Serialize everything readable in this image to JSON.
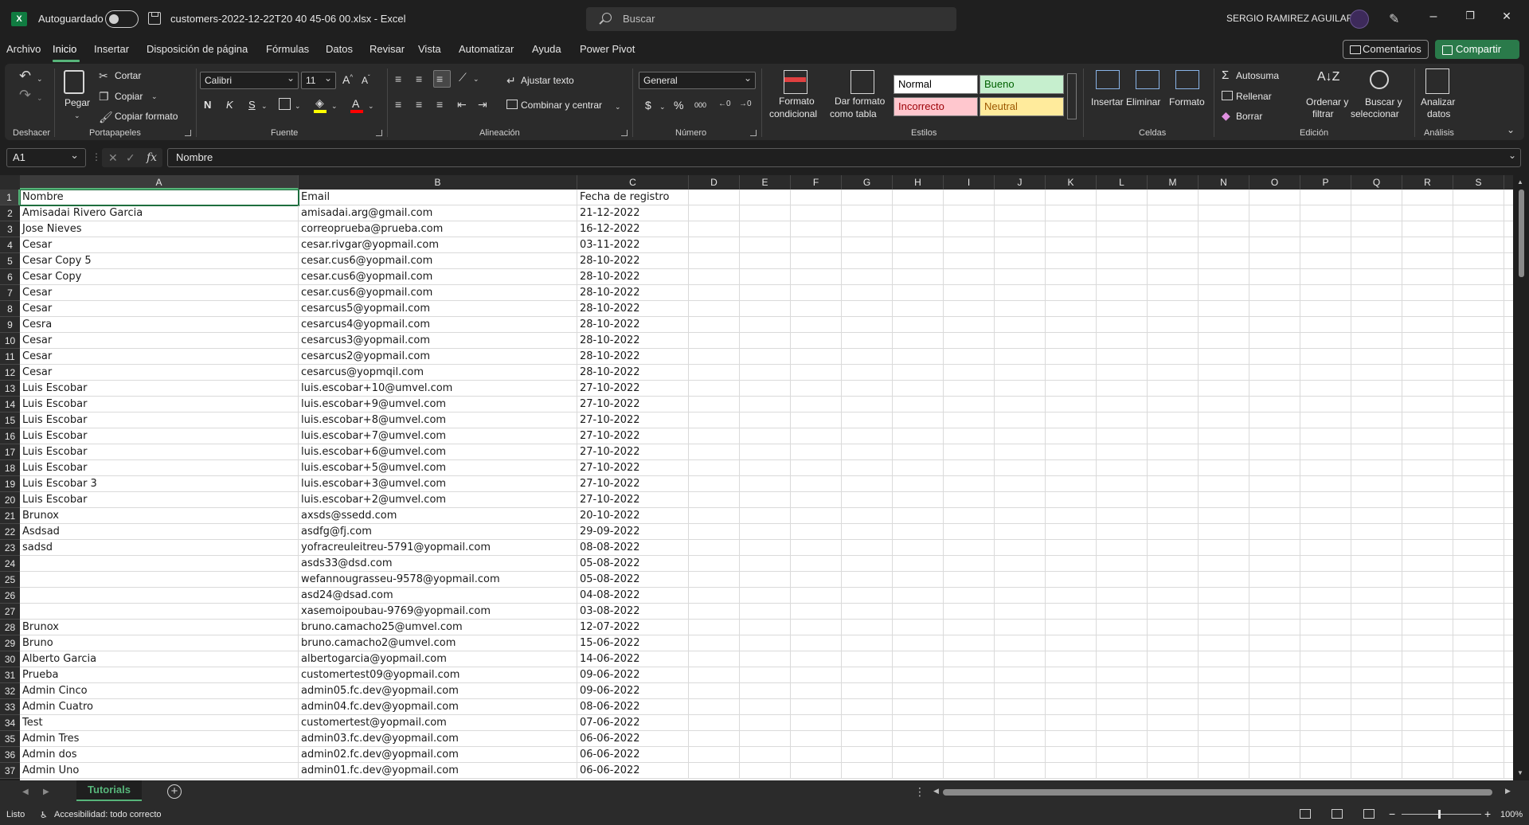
{
  "titlebar": {
    "app_icon": "excel-logo",
    "autosave_label": "Autoguardado",
    "filename": "customers-2022-12-22T20 40 45-06 00.xlsx  -  Excel",
    "search_placeholder": "Buscar",
    "user_name": "SERGIO RAMIREZ AGUILAR",
    "minimize": "–",
    "restore": "❐",
    "close": "✕"
  },
  "menu": {
    "tabs": [
      "Archivo",
      "Inicio",
      "Insertar",
      "Disposición de página",
      "Fórmulas",
      "Datos",
      "Revisar",
      "Vista",
      "Automatizar",
      "Ayuda",
      "Power Pivot"
    ],
    "active_tab": "Inicio",
    "comments": "Comentarios",
    "share": "Compartir"
  },
  "ribbon": {
    "groups": {
      "undo": "Deshacer",
      "clipboard": "Portapapeles",
      "font": "Fuente",
      "alignment": "Alineación",
      "number": "Número",
      "styles": "Estilos",
      "cells": "Celdas",
      "editing": "Edición",
      "analysis": "Análisis"
    },
    "clipboard": {
      "paste": "Pegar",
      "cut": "Cortar",
      "copy": "Copiar",
      "format_painter": "Copiar formato"
    },
    "font": {
      "name": "Calibri",
      "size": "11",
      "bold": "N",
      "italic": "K",
      "underline": "S"
    },
    "alignment": {
      "wrap": "Ajustar texto",
      "merge": "Combinar y centrar"
    },
    "number": {
      "format": "General",
      "currency": "$",
      "percent": "%",
      "thousands": "000"
    },
    "styles": {
      "conditional_1": "Formato",
      "conditional_2": "condicional",
      "table_1": "Dar formato",
      "table_2": "como tabla",
      "normal": "Normal",
      "good": "Bueno",
      "bad": "Incorrecto",
      "neutral": "Neutral"
    },
    "cells": {
      "insert": "Insertar",
      "delete": "Eliminar",
      "format": "Formato"
    },
    "editing": {
      "autosum": "Autosuma",
      "fill": "Rellenar",
      "clear": "Borrar",
      "sort_1": "Ordenar y",
      "sort_2": "filtrar",
      "find_1": "Buscar y",
      "find_2": "seleccionar"
    },
    "analysis": {
      "analyze_1": "Analizar",
      "analyze_2": "datos"
    }
  },
  "formula_bar": {
    "name_box": "A1",
    "fx": "fx",
    "content": "Nombre"
  },
  "columns": [
    "A",
    "B",
    "C",
    "D",
    "E",
    "F",
    "G",
    "H",
    "I",
    "J",
    "K",
    "L",
    "M",
    "N",
    "O",
    "P",
    "Q",
    "R",
    "S"
  ],
  "rows": [
    [
      "Nombre",
      "Email",
      "Fecha de registro"
    ],
    [
      "Amisadai Rivero Garcia",
      "amisadai.arg@gmail.com",
      "21-12-2022"
    ],
    [
      "Jose Nieves",
      "correoprueba@prueba.com",
      "16-12-2022"
    ],
    [
      "Cesar",
      "cesar.rivgar@yopmail.com",
      "03-11-2022"
    ],
    [
      "Cesar Copy 5",
      "cesar.cus6@yopmail.com",
      "28-10-2022"
    ],
    [
      "Cesar Copy",
      "cesar.cus6@yopmail.com",
      "28-10-2022"
    ],
    [
      "Cesar",
      "cesar.cus6@yopmail.com",
      "28-10-2022"
    ],
    [
      "Cesar",
      "cesarcus5@yopmail.com",
      "28-10-2022"
    ],
    [
      "Cesra",
      "cesarcus4@yopmail.com",
      "28-10-2022"
    ],
    [
      "Cesar",
      "cesarcus3@yopmail.com",
      "28-10-2022"
    ],
    [
      "Cesar",
      "cesarcus2@yopmail.com",
      "28-10-2022"
    ],
    [
      "Cesar",
      "cesarcus@yopmqil.com",
      "28-10-2022"
    ],
    [
      "Luis Escobar",
      "luis.escobar+10@umvel.com",
      "27-10-2022"
    ],
    [
      "Luis Escobar",
      "luis.escobar+9@umvel.com",
      "27-10-2022"
    ],
    [
      "Luis Escobar",
      "luis.escobar+8@umvel.com",
      "27-10-2022"
    ],
    [
      "Luis Escobar",
      "luis.escobar+7@umvel.com",
      "27-10-2022"
    ],
    [
      "Luis Escobar",
      "luis.escobar+6@umvel.com",
      "27-10-2022"
    ],
    [
      "Luis Escobar",
      "luis.escobar+5@umvel.com",
      "27-10-2022"
    ],
    [
      "Luis Escobar  3",
      "luis.escobar+3@umvel.com",
      "27-10-2022"
    ],
    [
      "Luis Escobar",
      "luis.escobar+2@umvel.com",
      "27-10-2022"
    ],
    [
      "Brunox",
      "axsds@ssedd.com",
      "20-10-2022"
    ],
    [
      "Asdsad",
      "asdfg@fj.com",
      "29-09-2022"
    ],
    [
      "sadsd",
      "yofracreuleitreu-5791@yopmail.com",
      "08-08-2022"
    ],
    [
      "",
      "asds33@dsd.com",
      "05-08-2022"
    ],
    [
      "",
      "wefannougrasseu-9578@yopmail.com",
      "05-08-2022"
    ],
    [
      "",
      "asd24@dsad.com",
      "04-08-2022"
    ],
    [
      "",
      "xasemoipoubau-9769@yopmail.com",
      "03-08-2022"
    ],
    [
      "Brunox",
      "bruno.camacho25@umvel.com",
      "12-07-2022"
    ],
    [
      "Bruno",
      "bruno.camacho2@umvel.com",
      "15-06-2022"
    ],
    [
      "Alberto Garcia",
      "albertogarcia@yopmail.com",
      "14-06-2022"
    ],
    [
      "Prueba",
      "customertest09@yopmail.com",
      "09-06-2022"
    ],
    [
      "Admin Cinco",
      "admin05.fc.dev@yopmail.com",
      "09-06-2022"
    ],
    [
      "Admin Cuatro",
      "admin04.fc.dev@yopmail.com",
      "08-06-2022"
    ],
    [
      "Test",
      "customertest@yopmail.com",
      "07-06-2022"
    ],
    [
      "Admin Tres",
      "admin03.fc.dev@yopmail.com",
      "06-06-2022"
    ],
    [
      "Admin dos",
      "admin02.fc.dev@yopmail.com",
      "06-06-2022"
    ],
    [
      "Admin Uno",
      "admin01.fc.dev@yopmail.com",
      "06-06-2022"
    ]
  ],
  "sheet_tabs": {
    "active": "Tutorials",
    "add": "+"
  },
  "status": {
    "ready": "Listo",
    "accessibility": "Accesibilidad: todo correcto",
    "zoom": "100%"
  }
}
